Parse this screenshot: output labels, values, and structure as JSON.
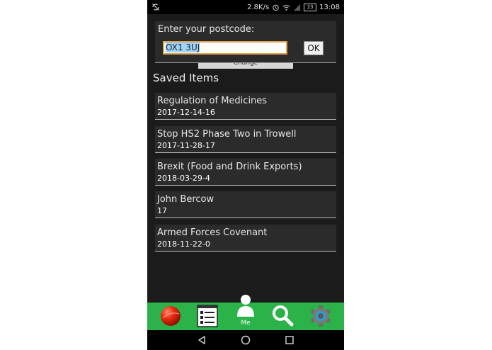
{
  "status_bar": {
    "speed": "2.8K/s",
    "battery": "23",
    "time": "13:08"
  },
  "postcode": {
    "label": "Enter your postcode:",
    "value": "OX1 3UJ",
    "ok_label": "OK",
    "change_label": "Change"
  },
  "saved": {
    "heading": "Saved Items",
    "items": [
      {
        "title": "Regulation of Medicines",
        "date": "2017-12-14-16"
      },
      {
        "title": "Stop HS2 Phase Two in Trowell",
        "date": "2017-11-28-17"
      },
      {
        "title": "Brexit (Food and Drink Exports)",
        "date": "2018-03-29-4"
      },
      {
        "title": "John Bercow",
        "date": "17"
      },
      {
        "title": "Armed Forces Covenant",
        "date": "2018-11-22-0"
      }
    ]
  },
  "bottom_nav": {
    "items": [
      {
        "icon": "red-ball-icon"
      },
      {
        "icon": "list-icon"
      },
      {
        "icon": "person-icon",
        "label": "Me"
      },
      {
        "icon": "search-icon"
      },
      {
        "icon": "settings-gear-icon"
      }
    ]
  },
  "colors": {
    "nav_green": "#2bb34a",
    "background": "#1b1b1b",
    "panel": "#2b2b2b",
    "input_border": "#e0a24a",
    "selection": "#9fd4ff"
  }
}
